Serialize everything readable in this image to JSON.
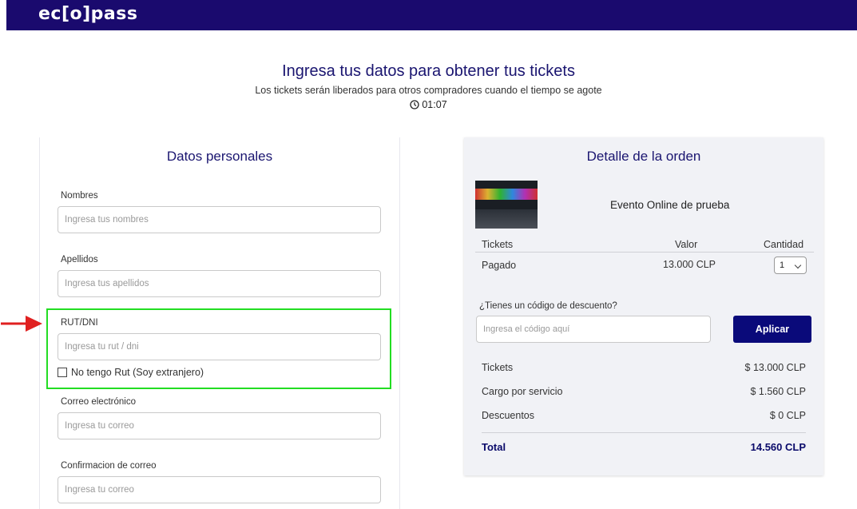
{
  "header": {
    "logo": "ec[o]pass"
  },
  "intro": {
    "title": "Ingresa tus datos para obtener tus tickets",
    "subtitle": "Los tickets serán liberados para otros compradores cuando el tiempo se agote",
    "timer": "01:07"
  },
  "personal": {
    "title": "Datos personales",
    "fields": [
      {
        "label": "Nombres",
        "placeholder": "Ingresa tus nombres"
      },
      {
        "label": "Apellidos",
        "placeholder": "Ingresa tus apellidos"
      },
      {
        "label": "RUT/DNI",
        "placeholder": "Ingresa tu rut / dni"
      },
      {
        "label": "Correo electrónico",
        "placeholder": "Ingresa tu correo"
      },
      {
        "label": "Confirmacion de correo",
        "placeholder": "Ingresa tu correo"
      }
    ],
    "no_rut_checkbox": "No tengo Rut (Soy extranjero)"
  },
  "order": {
    "title": "Detalle de la orden",
    "event_name": "Evento Online de prueba",
    "table": {
      "headers": [
        "Tickets",
        "Valor",
        "Cantidad"
      ],
      "rows": [
        {
          "ticket": "Pagado",
          "value": "13.000 CLP",
          "quantity": "1"
        }
      ]
    },
    "discount": {
      "label": "¿Tienes un código de descuento?",
      "placeholder": "Ingresa el código aquí",
      "button": "Aplicar"
    },
    "summary": [
      {
        "label": "Tickets",
        "value": "$ 13.000 CLP"
      },
      {
        "label": "Cargo por servicio",
        "value": "$ 1.560 CLP"
      },
      {
        "label": "Descuentos",
        "value": "$ 0 CLP"
      }
    ],
    "total": {
      "label": "Total",
      "value": "14.560 CLP"
    }
  },
  "colors": {
    "brand": "#1a0a6e",
    "button": "#0a0a7a",
    "highlight": "#22dd22",
    "arrow": "#e02020"
  }
}
